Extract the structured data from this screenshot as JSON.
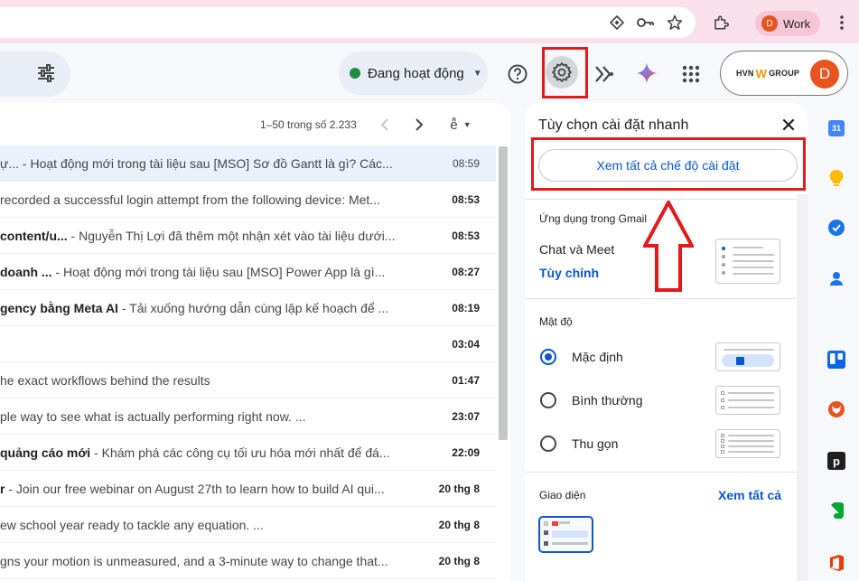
{
  "browser": {
    "profile": {
      "avatar_letter": "D",
      "name": "Work"
    }
  },
  "header": {
    "status": {
      "label": "Đang hoạt động",
      "color": "#1e8e3e"
    },
    "account": {
      "company_logo_text": "HVN",
      "company_logo_suffix": "GROUP",
      "avatar_letter": "D"
    }
  },
  "mail_list": {
    "pager": "1–50 trong số 2.233",
    "rows": [
      {
        "sender": "ự...",
        "snippet": " - Hoạt động mới trong tài liệu sau [MSO] Sơ đồ Gantt là gì? Các...",
        "time": "08:59",
        "unread": false,
        "selected": true
      },
      {
        "sender": "",
        "snippet": "recorded a successful login attempt from the following device: Met...",
        "time": "08:53",
        "unread": true,
        "selected": false
      },
      {
        "sender": "content/u...",
        "snippet": " - Nguyễn Thị Lợi đã thêm một nhận xét vào tài liệu dưới...",
        "time": "08:53",
        "unread": true,
        "selected": false
      },
      {
        "sender": " doanh ...",
        "snippet": " - Hoạt động mới trong tài liệu sau [MSO] Power App là gì...",
        "time": "08:27",
        "unread": true,
        "selected": false
      },
      {
        "sender": "gency bằng Meta AI",
        "snippet": " - Tải xuống hướng dẫn cùng lập kế hoạch để ...",
        "time": "08:19",
        "unread": true,
        "selected": false
      },
      {
        "sender": "",
        "snippet": "",
        "time": "03:04",
        "unread": true,
        "selected": false
      },
      {
        "sender": "",
        "snippet": "he exact workflows behind the results",
        "time": "01:47",
        "unread": true,
        "selected": false
      },
      {
        "sender": "",
        "snippet": "ple way to see what is actually performing right now.                 ...",
        "time": "23:07",
        "unread": true,
        "selected": false
      },
      {
        "sender": "quảng cáo mới",
        "snippet": " - Khám phá các công cụ tối ưu hóa mới nhất để đá...",
        "time": "22:09",
        "unread": true,
        "selected": false
      },
      {
        "sender": "r",
        "snippet": " - Join our free webinar on August 27th to learn how to build AI qui...",
        "time": "20 thg 8",
        "unread": true,
        "selected": false
      },
      {
        "sender": "",
        "snippet": "ew school year ready to tackle any equation.                             ...",
        "time": "20 thg 8",
        "unread": true,
        "selected": false
      },
      {
        "sender": "",
        "snippet": "gns your motion is unmeasured, and a 3-minute way to change that...",
        "time": "20 thg 8",
        "unread": true,
        "selected": false
      }
    ]
  },
  "quick_settings": {
    "title": "Tùy chọn cài đặt nhanh",
    "see_all_button": "Xem tất cả chế độ cài đặt",
    "apps_section": {
      "label": "Ứng dụng trong Gmail",
      "item": "Chat và Meet",
      "customize_link": "Tùy chỉnh"
    },
    "density_section": {
      "label": "Mật độ",
      "options": [
        {
          "label": "Mặc định",
          "selected": true
        },
        {
          "label": "Bình thường",
          "selected": false
        },
        {
          "label": "Thu gọn",
          "selected": false
        }
      ]
    },
    "theme_section": {
      "label": "Giao diện",
      "see_all_link": "Xem tất cả"
    }
  },
  "side_panel": {
    "icons": [
      "calendar-icon",
      "keep-icon",
      "tasks-icon",
      "contacts-icon",
      "trello-icon",
      "addon-fox-icon",
      "addon-p-icon",
      "evernote-icon",
      "office-icon"
    ],
    "calendar_day": "31"
  },
  "annotations": {
    "highlight_color": "#e3191c"
  }
}
